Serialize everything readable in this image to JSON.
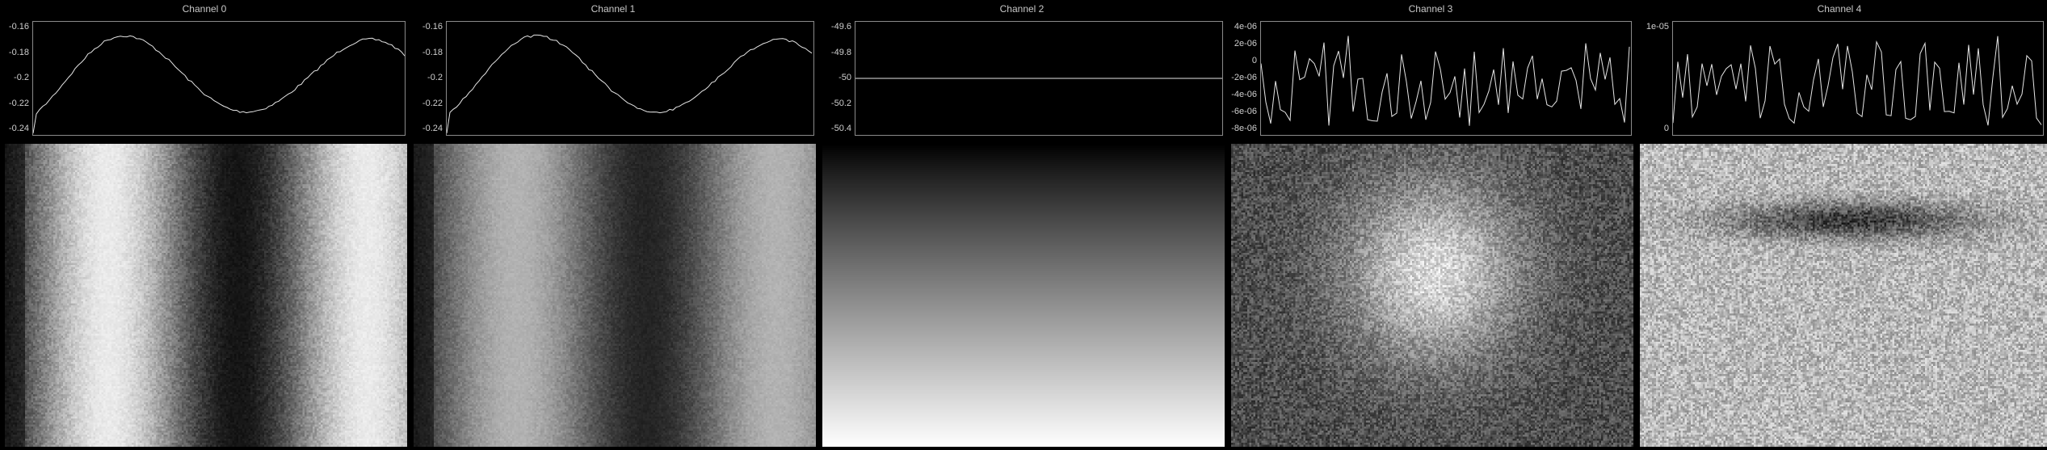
{
  "channels": [
    {
      "title": "Channel 0",
      "yticks": [
        "-0.16",
        "-0.18",
        "-0.2",
        "-0.22",
        "-0.24"
      ],
      "signal": "wave",
      "image": "stripes_a"
    },
    {
      "title": "Channel 1",
      "yticks": [
        "-0.16",
        "-0.18",
        "-0.2",
        "-0.22",
        "-0.24"
      ],
      "signal": "wave",
      "image": "stripes_b"
    },
    {
      "title": "Channel 2",
      "yticks": [
        "-49.6",
        "-49.8",
        "-50",
        "-50.2",
        "-50.4"
      ],
      "signal": "flat",
      "image": "gradient"
    },
    {
      "title": "Channel 3",
      "yticks": [
        "4e-06",
        "2e-06",
        "0",
        "-2e-06",
        "-4e-06",
        "-6e-06",
        "-8e-06"
      ],
      "signal": "noise",
      "image": "blob_bright"
    },
    {
      "title": "Channel 4",
      "yticks": [
        "1e-05",
        "0"
      ],
      "signal": "noise",
      "image": "blob_dark"
    }
  ]
}
